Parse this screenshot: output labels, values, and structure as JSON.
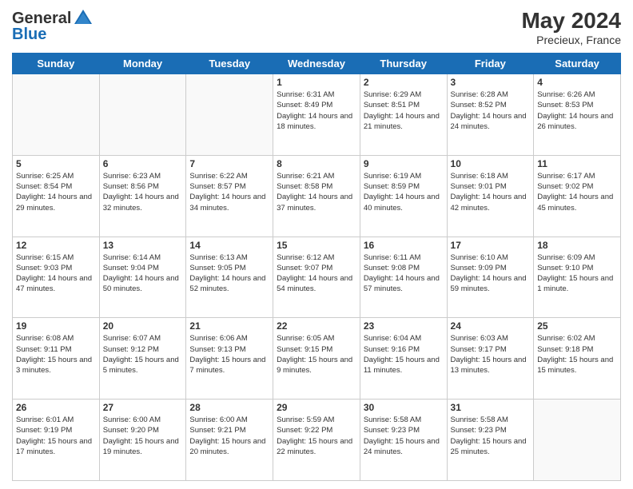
{
  "header": {
    "logo_general": "General",
    "logo_blue": "Blue",
    "month_year": "May 2024",
    "location": "Precieux, France"
  },
  "days_of_week": [
    "Sunday",
    "Monday",
    "Tuesday",
    "Wednesday",
    "Thursday",
    "Friday",
    "Saturday"
  ],
  "weeks": [
    [
      {
        "day": "",
        "sunrise": "",
        "sunset": "",
        "daylight": "",
        "empty": true
      },
      {
        "day": "",
        "sunrise": "",
        "sunset": "",
        "daylight": "",
        "empty": true
      },
      {
        "day": "",
        "sunrise": "",
        "sunset": "",
        "daylight": "",
        "empty": true
      },
      {
        "day": "1",
        "sunrise": "Sunrise: 6:31 AM",
        "sunset": "Sunset: 8:49 PM",
        "daylight": "Daylight: 14 hours and 18 minutes.",
        "empty": false
      },
      {
        "day": "2",
        "sunrise": "Sunrise: 6:29 AM",
        "sunset": "Sunset: 8:51 PM",
        "daylight": "Daylight: 14 hours and 21 minutes.",
        "empty": false
      },
      {
        "day": "3",
        "sunrise": "Sunrise: 6:28 AM",
        "sunset": "Sunset: 8:52 PM",
        "daylight": "Daylight: 14 hours and 24 minutes.",
        "empty": false
      },
      {
        "day": "4",
        "sunrise": "Sunrise: 6:26 AM",
        "sunset": "Sunset: 8:53 PM",
        "daylight": "Daylight: 14 hours and 26 minutes.",
        "empty": false
      }
    ],
    [
      {
        "day": "5",
        "sunrise": "Sunrise: 6:25 AM",
        "sunset": "Sunset: 8:54 PM",
        "daylight": "Daylight: 14 hours and 29 minutes.",
        "empty": false
      },
      {
        "day": "6",
        "sunrise": "Sunrise: 6:23 AM",
        "sunset": "Sunset: 8:56 PM",
        "daylight": "Daylight: 14 hours and 32 minutes.",
        "empty": false
      },
      {
        "day": "7",
        "sunrise": "Sunrise: 6:22 AM",
        "sunset": "Sunset: 8:57 PM",
        "daylight": "Daylight: 14 hours and 34 minutes.",
        "empty": false
      },
      {
        "day": "8",
        "sunrise": "Sunrise: 6:21 AM",
        "sunset": "Sunset: 8:58 PM",
        "daylight": "Daylight: 14 hours and 37 minutes.",
        "empty": false
      },
      {
        "day": "9",
        "sunrise": "Sunrise: 6:19 AM",
        "sunset": "Sunset: 8:59 PM",
        "daylight": "Daylight: 14 hours and 40 minutes.",
        "empty": false
      },
      {
        "day": "10",
        "sunrise": "Sunrise: 6:18 AM",
        "sunset": "Sunset: 9:01 PM",
        "daylight": "Daylight: 14 hours and 42 minutes.",
        "empty": false
      },
      {
        "day": "11",
        "sunrise": "Sunrise: 6:17 AM",
        "sunset": "Sunset: 9:02 PM",
        "daylight": "Daylight: 14 hours and 45 minutes.",
        "empty": false
      }
    ],
    [
      {
        "day": "12",
        "sunrise": "Sunrise: 6:15 AM",
        "sunset": "Sunset: 9:03 PM",
        "daylight": "Daylight: 14 hours and 47 minutes.",
        "empty": false
      },
      {
        "day": "13",
        "sunrise": "Sunrise: 6:14 AM",
        "sunset": "Sunset: 9:04 PM",
        "daylight": "Daylight: 14 hours and 50 minutes.",
        "empty": false
      },
      {
        "day": "14",
        "sunrise": "Sunrise: 6:13 AM",
        "sunset": "Sunset: 9:05 PM",
        "daylight": "Daylight: 14 hours and 52 minutes.",
        "empty": false
      },
      {
        "day": "15",
        "sunrise": "Sunrise: 6:12 AM",
        "sunset": "Sunset: 9:07 PM",
        "daylight": "Daylight: 14 hours and 54 minutes.",
        "empty": false
      },
      {
        "day": "16",
        "sunrise": "Sunrise: 6:11 AM",
        "sunset": "Sunset: 9:08 PM",
        "daylight": "Daylight: 14 hours and 57 minutes.",
        "empty": false
      },
      {
        "day": "17",
        "sunrise": "Sunrise: 6:10 AM",
        "sunset": "Sunset: 9:09 PM",
        "daylight": "Daylight: 14 hours and 59 minutes.",
        "empty": false
      },
      {
        "day": "18",
        "sunrise": "Sunrise: 6:09 AM",
        "sunset": "Sunset: 9:10 PM",
        "daylight": "Daylight: 15 hours and 1 minute.",
        "empty": false
      }
    ],
    [
      {
        "day": "19",
        "sunrise": "Sunrise: 6:08 AM",
        "sunset": "Sunset: 9:11 PM",
        "daylight": "Daylight: 15 hours and 3 minutes.",
        "empty": false
      },
      {
        "day": "20",
        "sunrise": "Sunrise: 6:07 AM",
        "sunset": "Sunset: 9:12 PM",
        "daylight": "Daylight: 15 hours and 5 minutes.",
        "empty": false
      },
      {
        "day": "21",
        "sunrise": "Sunrise: 6:06 AM",
        "sunset": "Sunset: 9:13 PM",
        "daylight": "Daylight: 15 hours and 7 minutes.",
        "empty": false
      },
      {
        "day": "22",
        "sunrise": "Sunrise: 6:05 AM",
        "sunset": "Sunset: 9:15 PM",
        "daylight": "Daylight: 15 hours and 9 minutes.",
        "empty": false
      },
      {
        "day": "23",
        "sunrise": "Sunrise: 6:04 AM",
        "sunset": "Sunset: 9:16 PM",
        "daylight": "Daylight: 15 hours and 11 minutes.",
        "empty": false
      },
      {
        "day": "24",
        "sunrise": "Sunrise: 6:03 AM",
        "sunset": "Sunset: 9:17 PM",
        "daylight": "Daylight: 15 hours and 13 minutes.",
        "empty": false
      },
      {
        "day": "25",
        "sunrise": "Sunrise: 6:02 AM",
        "sunset": "Sunset: 9:18 PM",
        "daylight": "Daylight: 15 hours and 15 minutes.",
        "empty": false
      }
    ],
    [
      {
        "day": "26",
        "sunrise": "Sunrise: 6:01 AM",
        "sunset": "Sunset: 9:19 PM",
        "daylight": "Daylight: 15 hours and 17 minutes.",
        "empty": false
      },
      {
        "day": "27",
        "sunrise": "Sunrise: 6:00 AM",
        "sunset": "Sunset: 9:20 PM",
        "daylight": "Daylight: 15 hours and 19 minutes.",
        "empty": false
      },
      {
        "day": "28",
        "sunrise": "Sunrise: 6:00 AM",
        "sunset": "Sunset: 9:21 PM",
        "daylight": "Daylight: 15 hours and 20 minutes.",
        "empty": false
      },
      {
        "day": "29",
        "sunrise": "Sunrise: 5:59 AM",
        "sunset": "Sunset: 9:22 PM",
        "daylight": "Daylight: 15 hours and 22 minutes.",
        "empty": false
      },
      {
        "day": "30",
        "sunrise": "Sunrise: 5:58 AM",
        "sunset": "Sunset: 9:23 PM",
        "daylight": "Daylight: 15 hours and 24 minutes.",
        "empty": false
      },
      {
        "day": "31",
        "sunrise": "Sunrise: 5:58 AM",
        "sunset": "Sunset: 9:23 PM",
        "daylight": "Daylight: 15 hours and 25 minutes.",
        "empty": false
      },
      {
        "day": "",
        "sunrise": "",
        "sunset": "",
        "daylight": "",
        "empty": true
      }
    ]
  ]
}
